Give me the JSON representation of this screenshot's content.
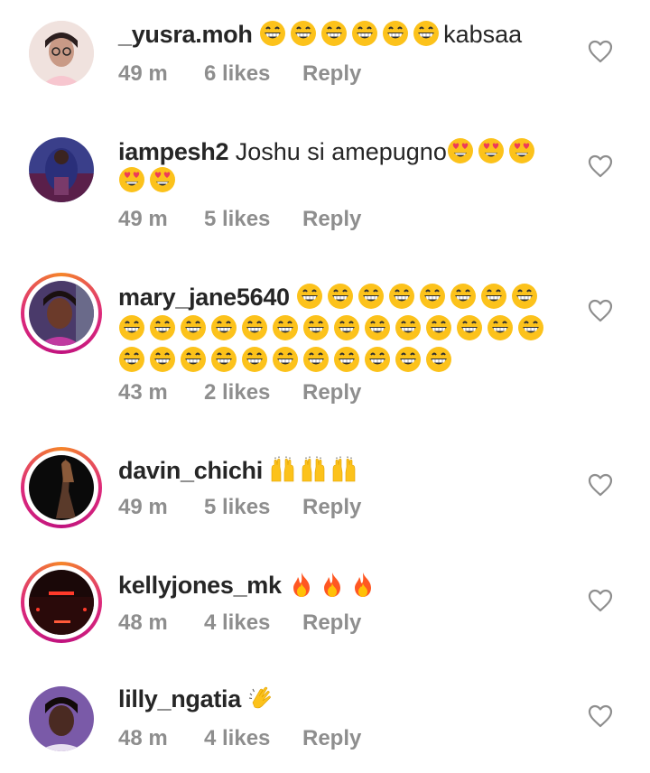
{
  "comments": [
    {
      "username": "_yusra.moh",
      "text": "kabsaa",
      "emojis_before": [
        "grin",
        "grin",
        "grin",
        "grin",
        "grin",
        "grin"
      ],
      "emojis_after": [],
      "time": "49 m",
      "likes": "6 likes",
      "reply": "Reply",
      "ring": false
    },
    {
      "username": "iampesh2",
      "text": "Joshu si amepugno",
      "emojis_before": [],
      "emojis_after": [
        "heart-eyes",
        "heart-eyes",
        "heart-eyes",
        "heart-eyes",
        "heart-eyes"
      ],
      "time": "49 m",
      "likes": "5 likes",
      "reply": "Reply",
      "ring": false
    },
    {
      "username": "mary_jane5640",
      "text": "",
      "emojis_before": [],
      "emojis_after": [
        "grin",
        "grin",
        "grin",
        "grin",
        "grin",
        "grin",
        "grin",
        "grin",
        "grin",
        "grin",
        "grin",
        "grin",
        "grin",
        "grin",
        "grin",
        "grin",
        "grin",
        "grin",
        "grin",
        "grin",
        "grin",
        "grin",
        "grin",
        "grin",
        "grin",
        "grin",
        "grin",
        "grin",
        "grin",
        "grin",
        "grin",
        "grin",
        "grin"
      ],
      "time": "43 m",
      "likes": "2 likes",
      "reply": "Reply",
      "ring": true
    },
    {
      "username": "davin_chichi",
      "text": "",
      "emojis_before": [],
      "emojis_after": [
        "raised-hands",
        "raised-hands",
        "raised-hands"
      ],
      "time": "49 m",
      "likes": "5 likes",
      "reply": "Reply",
      "ring": true
    },
    {
      "username": "kellyjones_mk",
      "text": "",
      "emojis_before": [],
      "emojis_after": [
        "fire",
        "fire",
        "fire"
      ],
      "time": "48 m",
      "likes": "4 likes",
      "reply": "Reply",
      "ring": true
    },
    {
      "username": "lilly_ngatia",
      "text": "",
      "emojis_before": [],
      "emojis_after": [
        "clapping-hands"
      ],
      "time": "48 m",
      "likes": "4 likes",
      "reply": "Reply",
      "ring": false
    }
  ],
  "colors": {
    "username": "#262626",
    "meta": "#8e8e8e",
    "ring_start": "#f58529",
    "ring_end": "#dd2a7b"
  },
  "icons": {
    "like": "heart-outline-icon"
  }
}
